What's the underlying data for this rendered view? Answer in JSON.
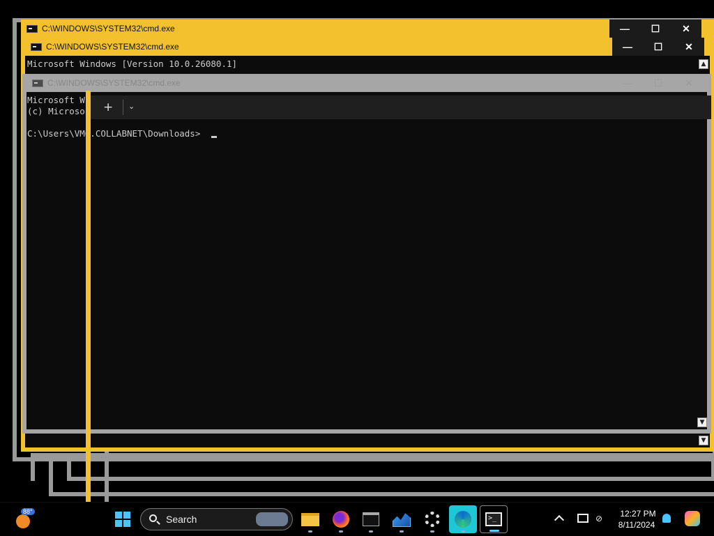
{
  "windows": {
    "back": {
      "title": "C:\\WINDOWS\\SYSTEM32\\cmd.exe"
    },
    "middle": {
      "title": "C:\\WINDOWS\\SYSTEM32\\cmd.exe",
      "line1": "Microsoft Windows [Version 10.0.26080.1]"
    },
    "front": {
      "title": "C:\\WINDOWS\\SYSTEM32\\cmd.exe",
      "line1": "Microsoft W",
      "line2": "(c) Microso",
      "prompt": "C:\\Users\\VM6.COLLABNET\\Downloads>"
    }
  },
  "controls": {
    "minimize": "—",
    "maximize": "☐",
    "close": "✕"
  },
  "terminal_tabs": {
    "new_tab": "+",
    "dropdown": "⌄"
  },
  "taskbar": {
    "weather_temp": "88°",
    "search_label": "Search",
    "apps": [
      {
        "name": "start"
      },
      {
        "name": "file-explorer"
      },
      {
        "name": "firefox"
      },
      {
        "name": "command-prompt"
      },
      {
        "name": "task-manager"
      },
      {
        "name": "settings"
      },
      {
        "name": "edge"
      },
      {
        "name": "terminal"
      }
    ],
    "clock_time": "12:27 PM",
    "clock_date": "8/11/2024"
  },
  "colors": {
    "accent": "#f3c12d",
    "inactive": "#9a9a9a",
    "console_bg": "#0c0c0c"
  }
}
